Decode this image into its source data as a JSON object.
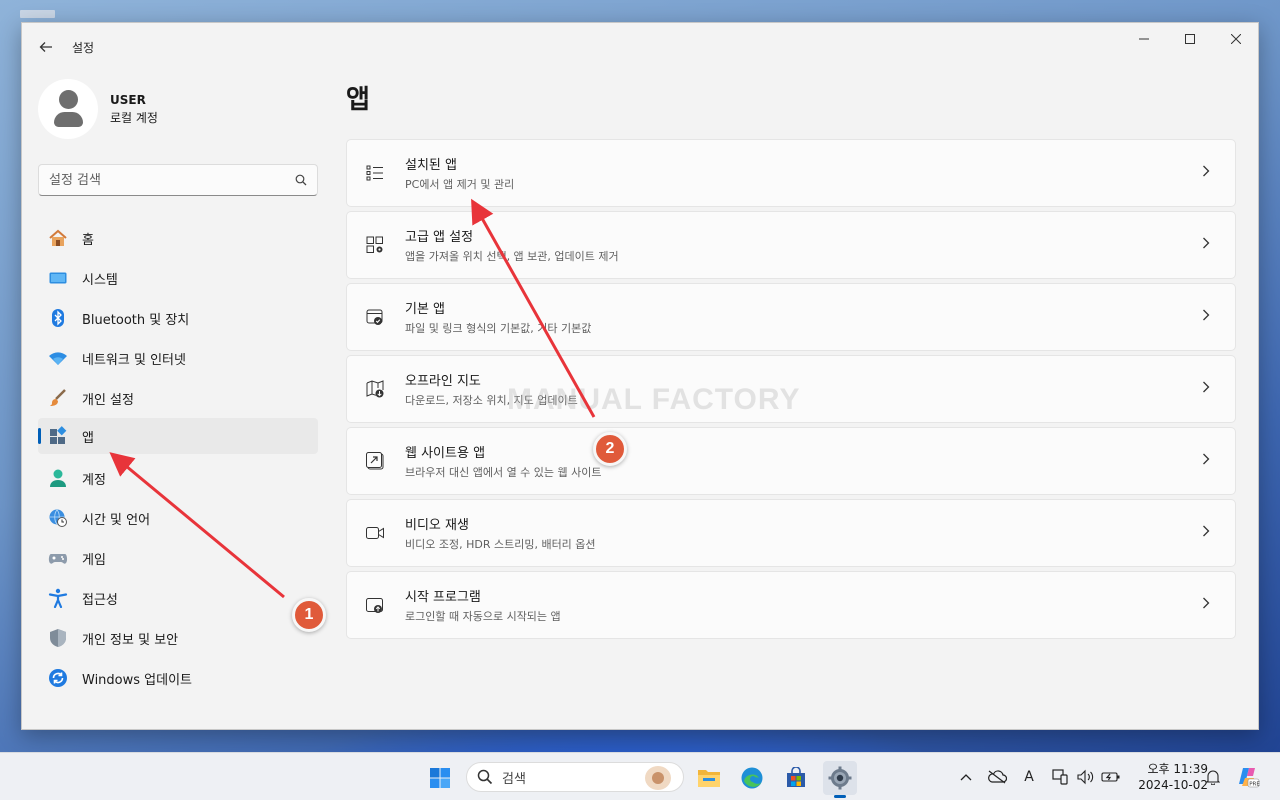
{
  "window": {
    "title": "설정",
    "back_icon": "back-arrow-icon",
    "controls": [
      "minimize-icon",
      "maximize-icon",
      "close-icon"
    ]
  },
  "profile": {
    "name": "USER",
    "account_type": "로컬 계정"
  },
  "search": {
    "placeholder": "설정 검색"
  },
  "sidebar": {
    "items": [
      {
        "label": "홈",
        "icon": "home-icon",
        "active": false
      },
      {
        "label": "시스템",
        "icon": "system-display-icon",
        "active": false
      },
      {
        "label": "Bluetooth 및 장치",
        "icon": "bluetooth-icon",
        "active": false
      },
      {
        "label": "네트워크 및 인터넷",
        "icon": "wifi-icon",
        "active": false
      },
      {
        "label": "개인 설정",
        "icon": "paintbrush-icon",
        "active": false
      },
      {
        "label": "앱",
        "icon": "apps-icon",
        "active": true
      },
      {
        "label": "계정",
        "icon": "account-icon",
        "active": false
      },
      {
        "label": "시간 및 언어",
        "icon": "globe-clock-icon",
        "active": false
      },
      {
        "label": "게임",
        "icon": "gamepad-icon",
        "active": false
      },
      {
        "label": "접근성",
        "icon": "accessibility-icon",
        "active": false
      },
      {
        "label": "개인 정보 및 보안",
        "icon": "shield-icon",
        "active": false
      },
      {
        "label": "Windows 업데이트",
        "icon": "update-icon",
        "active": false
      }
    ]
  },
  "main": {
    "title": "앱",
    "cards": [
      {
        "title": "설치된 앱",
        "subtitle": "PC에서 앱 제거 및 관리",
        "icon": "installed-apps-list-icon"
      },
      {
        "title": "고급 앱 설정",
        "subtitle": "앱을 가져올 위치 선택, 앱 보관, 업데이트 제거",
        "icon": "advanced-apps-icon"
      },
      {
        "title": "기본 앱",
        "subtitle": "파일 및 링크 형식의 기본값, 기타 기본값",
        "icon": "default-apps-icon"
      },
      {
        "title": "오프라인 지도",
        "subtitle": "다운로드, 저장소 위치, 지도 업데이트",
        "icon": "offline-map-icon"
      },
      {
        "title": "웹 사이트용 앱",
        "subtitle": "브라우저 대신 앱에서 열 수 있는 웹 사이트",
        "icon": "web-apps-icon"
      },
      {
        "title": "비디오 재생",
        "subtitle": "비디오 조정, HDR 스트리밍, 배터리 옵션",
        "icon": "video-camera-icon"
      },
      {
        "title": "시작 프로그램",
        "subtitle": "로그인할 때 자동으로 시작되는 앱",
        "icon": "startup-icon"
      }
    ]
  },
  "watermark": "MANUAL FACTORY",
  "annotations": {
    "badge1": "1",
    "badge2": "2",
    "color": "#e05a3a"
  },
  "taskbar": {
    "search_placeholder": "검색",
    "time_period": "오후 11:39",
    "date": "2024-10-02",
    "ime": "A"
  }
}
